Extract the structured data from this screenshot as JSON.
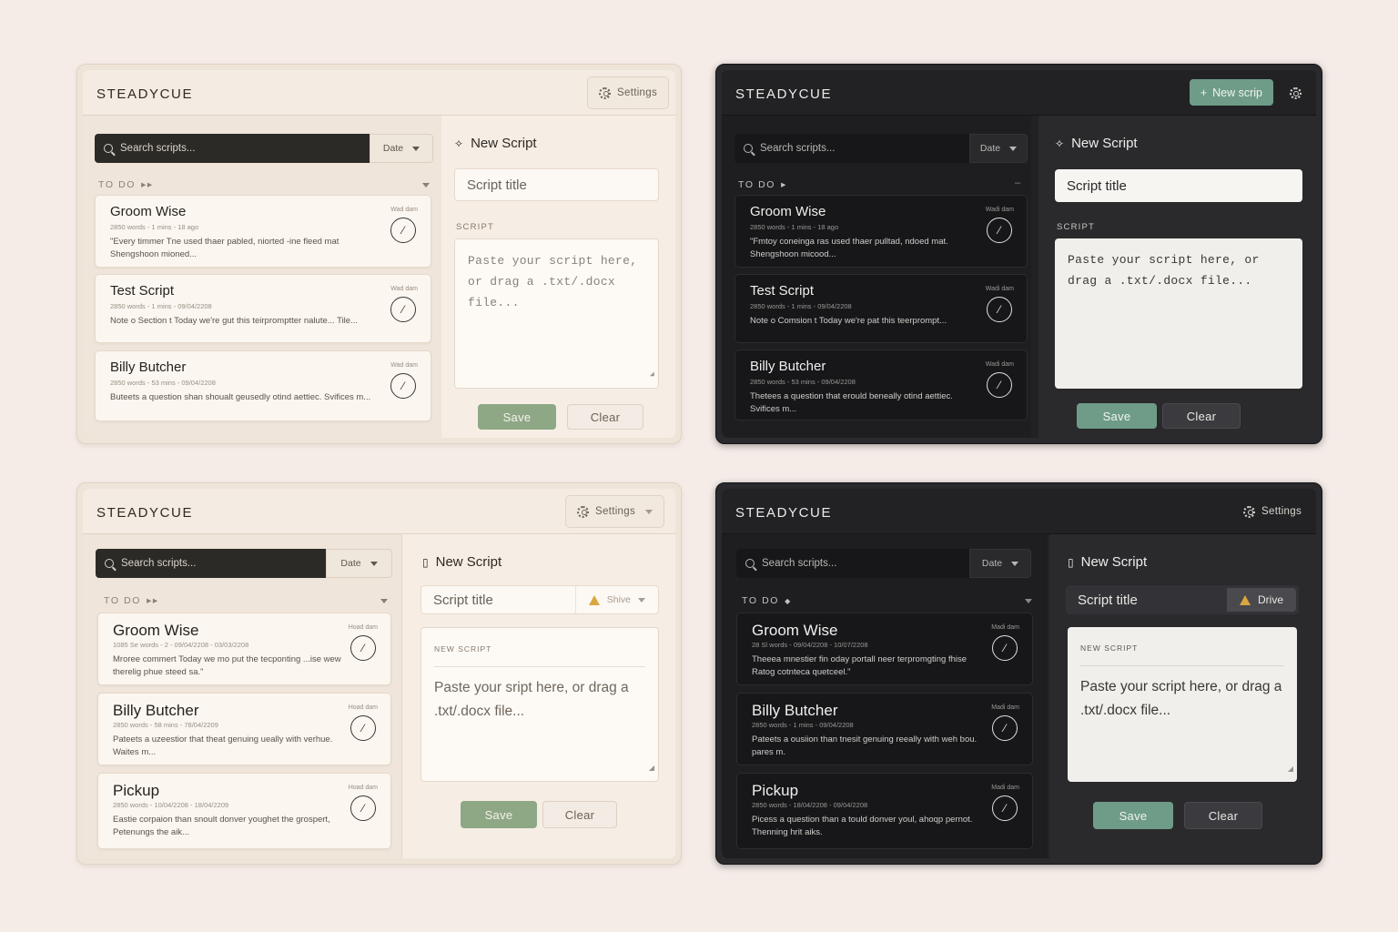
{
  "panels": [
    {
      "brand": "STEADYCUE",
      "settings_label": "Settings",
      "search_placeholder": "Search scripts...",
      "date_label": "Date",
      "section_label": "TO DO",
      "section_caret": "▸▸",
      "new_script_label": "New Script",
      "title_placeholder": "Script title",
      "script_label": "SCRIPT",
      "textarea_placeholder": "Paste your script here, or drag a .txt/.docx file...",
      "save_label": "Save",
      "clear_label": "Clear",
      "cards": [
        {
          "title": "Groom Wise",
          "meta": "2850 words  -  1 mins - 18 ago",
          "tag": "Wad dam",
          "body": "\"Every timmer Tne used thaer pabled, niorted -ine fleed mat Shengshoon mioned..."
        },
        {
          "title": "Test Script",
          "meta": "2850 words  -  1 mins - 09/04/2208",
          "tag": "Wad dam",
          "body": "Note o Section t Today we're gut this teirpromptter nalute... Tile..."
        },
        {
          "title": "Billy Butcher",
          "meta": "2850 words  -  53 mins - 09/04/2208",
          "tag": "Wad dam",
          "body": "Buteets a question shan shoualt geusedly otind aettiec. Svifices m..."
        }
      ]
    },
    {
      "brand": "STEADYCUE",
      "new_button_label": "New scrip",
      "search_placeholder": "Search scripts...",
      "date_label": "Date",
      "section_label": "TO DO",
      "section_caret": "▸",
      "new_script_label": "New Script",
      "title_placeholder": "Script title",
      "script_label": "SCRIPT",
      "textarea_placeholder": "Paste your script here, or drag a .txt/.docx file...",
      "save_label": "Save",
      "clear_label": "Clear",
      "cards": [
        {
          "title": "Groom Wise",
          "meta": "2850 words  -  1 mins - 18 ago",
          "tag": "Wadi dam",
          "body": "\"Fmtoy coneinga ras used thaer pulltad, ndoed mat. Shengshoon micood..."
        },
        {
          "title": "Test Script",
          "meta": "2850 words  -  1 mins - 09/04/2208",
          "tag": "Wadi dam",
          "body": "Note o Comsion t Today we're pat this teerprompt..."
        },
        {
          "title": "Billy Butcher",
          "meta": "2850 words  -  53 mins - 09/04/2208",
          "tag": "Wadi dam",
          "body": "Thetees a question that erould beneally otind aettiec. Svifices m..."
        }
      ]
    },
    {
      "brand": "STEADYCUE",
      "settings_label": "Settings",
      "search_placeholder": "Search scripts...",
      "date_label": "Date",
      "section_label": "TO DO",
      "section_caret": "▸▸",
      "new_script_label": "New Script",
      "title_placeholder": "Script title",
      "drive_label": "Shive",
      "textarea_header": "NEW SCRIPT",
      "textarea_placeholder": "Paste your sript here, or drag a .txt/.docx file...",
      "save_label": "Save",
      "clear_label": "Clear",
      "cards": [
        {
          "title": "Groom Wise",
          "meta": "1085 Se words  -  2 - 09/04/2208 - 03/03/2208",
          "tag": "Hoad dam",
          "body": "Mroree commert Today we mo put the tecponting ...ise wew therelig phue steed sa.\""
        },
        {
          "title": "Billy Butcher",
          "meta": "2850 words  -  58 mins - 78/04/2209",
          "tag": "Hoad dam",
          "body": "Pateets a uzeestior that theat genuing ueally with verhue. Waites m..."
        },
        {
          "title": "Pickup",
          "meta": "2850 words  -  10/04/2208 - 18/04/2209",
          "tag": "Hoad dam",
          "body": "Eastie corpaion than snoult donver youghet the grospert, Petenungs the aik..."
        }
      ]
    },
    {
      "brand": "STEADYCUE",
      "settings_label": "Settings",
      "search_placeholder": "Search scripts...",
      "date_label": "Date",
      "section_label": "TO DO",
      "section_caret": "◆",
      "new_script_label": "New Script",
      "title_placeholder": "Script title",
      "drive_label": "Drive",
      "textarea_header": "NEW SCRIPT",
      "textarea_placeholder": "Paste your script here, or drag a .txt/.docx file...",
      "save_label": "Save",
      "clear_label": "Clear",
      "cards": [
        {
          "title": "Groom Wise",
          "meta": "28 Sl words  -  09/04/2208 - 10/07/2208",
          "tag": "Madi dam",
          "body": "Theeea mnestier fin oday portall neer terpromgting fhise Ratog cotnteca quetceel.\""
        },
        {
          "title": "Billy Butcher",
          "meta": "2850 words  -  1 mins - 09/04/2208",
          "tag": "Madi dam",
          "body": "Pateets a ousiion than tnesit genuing reeally with weh bou. pares m."
        },
        {
          "title": "Pickup",
          "meta": "2850 words  -  18/04/2208 - 09/04/2208",
          "tag": "Madi dam",
          "body": "Picess a question than a tould donver youl, ahoqp pernot. Thenning hrit aiks."
        }
      ]
    }
  ]
}
